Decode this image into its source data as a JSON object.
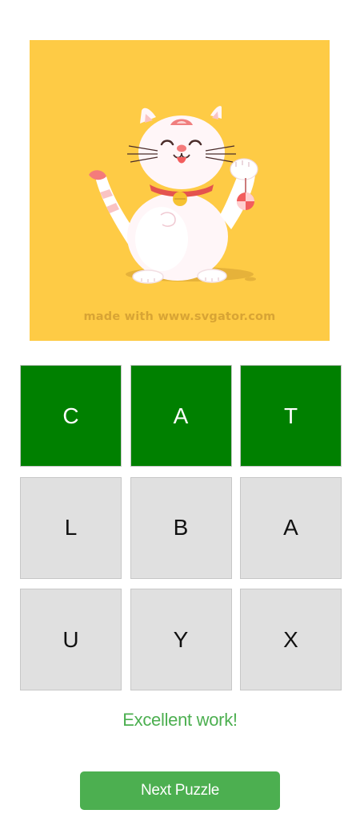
{
  "picture": {
    "subject": "lucky-cat-illustration",
    "watermark": "made with www.svgator.com",
    "background_color": "#fecb45"
  },
  "tiles": [
    {
      "letter": "C",
      "state": "correct"
    },
    {
      "letter": "A",
      "state": "correct"
    },
    {
      "letter": "T",
      "state": "correct"
    },
    {
      "letter": "L",
      "state": "unused"
    },
    {
      "letter": "B",
      "state": "unused"
    },
    {
      "letter": "A",
      "state": "unused"
    },
    {
      "letter": "U",
      "state": "unused"
    },
    {
      "letter": "Y",
      "state": "unused"
    },
    {
      "letter": "X",
      "state": "unused"
    }
  ],
  "colors": {
    "correct": "#008000",
    "unused": "#e0e0e0",
    "accent": "#4caf50"
  },
  "message": "Excellent work!",
  "next_button_label": "Next Puzzle"
}
